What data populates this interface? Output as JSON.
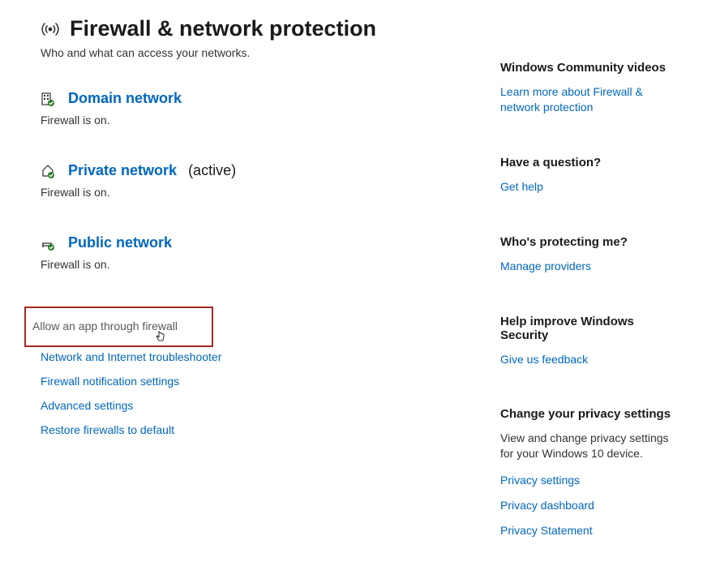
{
  "page": {
    "title": "Firewall & network protection",
    "subtitle": "Who and what can access your networks."
  },
  "networks": {
    "domain": {
      "label": "Domain network",
      "status": "Firewall is on.",
      "active": ""
    },
    "private": {
      "label": "Private network",
      "status": "Firewall is on.",
      "active": "(active)"
    },
    "public": {
      "label": "Public network",
      "status": "Firewall is on.",
      "active": ""
    }
  },
  "actions": {
    "allow_app": "Allow an app through firewall",
    "troubleshooter": "Network and Internet troubleshooter",
    "notifications": "Firewall notification settings",
    "advanced": "Advanced settings",
    "restore": "Restore firewalls to default"
  },
  "sidebar": {
    "community": {
      "heading": "Windows Community videos",
      "link": "Learn more about Firewall & network protection"
    },
    "question": {
      "heading": "Have a question?",
      "link": "Get help"
    },
    "protecting": {
      "heading": "Who's protecting me?",
      "link": "Manage providers"
    },
    "improve": {
      "heading": "Help improve Windows Security",
      "link": "Give us feedback"
    },
    "privacy": {
      "heading": "Change your privacy settings",
      "text": "View and change privacy settings for your Windows 10 device.",
      "link1": "Privacy settings",
      "link2": "Privacy dashboard",
      "link3": "Privacy Statement"
    }
  }
}
